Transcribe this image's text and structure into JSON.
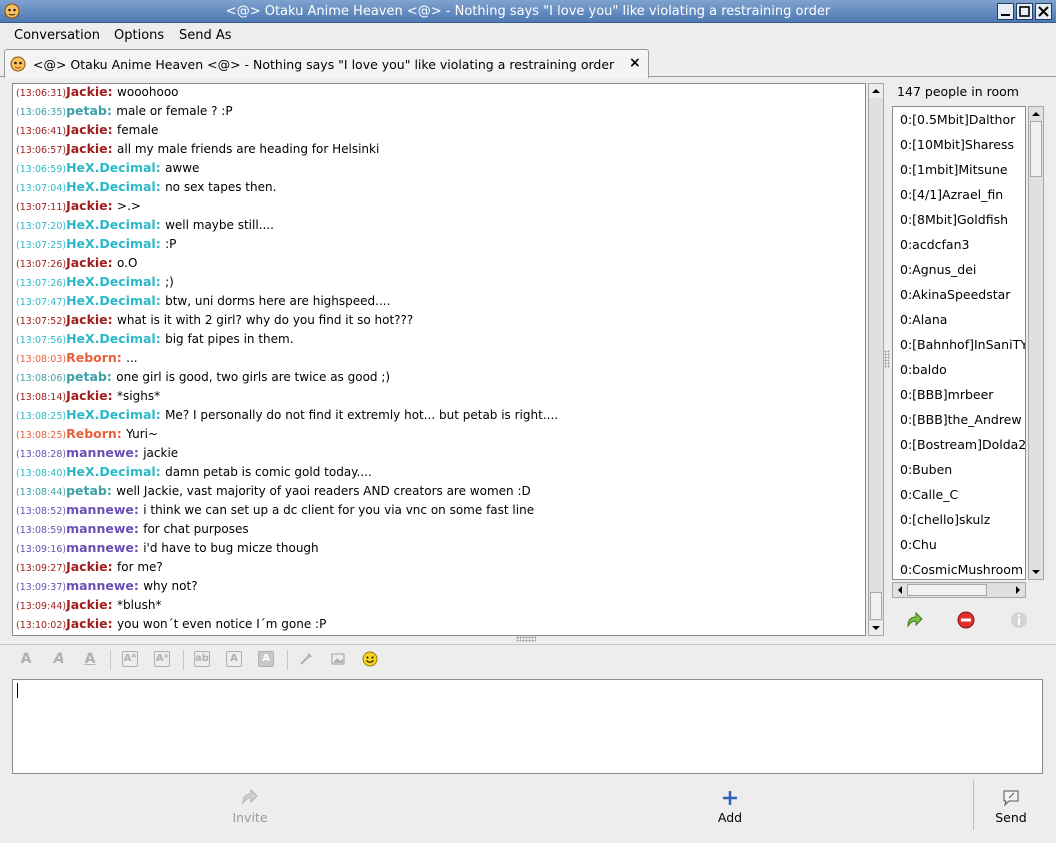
{
  "window": {
    "title": "<@> Otaku Anime Heaven <@> - Nothing says \"I love you\" like violating a restraining order"
  },
  "menu": {
    "conversation": "Conversation",
    "options": "Options",
    "send_as": "Send As"
  },
  "tab": {
    "label": "<@> Otaku Anime Heaven <@> - Nothing says \"I love you\" like violating a restraining order",
    "close": "×"
  },
  "colors": {
    "Jackie": "#a11d1d",
    "petab": "#3e9fa6",
    "HeX.Decimal": "#2bb8c8",
    "Reborn": "#e8603c",
    "mannewe": "#6a4fb3"
  },
  "messages": [
    {
      "time": "(13:06:31)",
      "nick": "Jackie",
      "text": "wooohooo"
    },
    {
      "time": "(13:06:35)",
      "nick": "petab",
      "text": "male or female ? :P"
    },
    {
      "time": "(13:06:41)",
      "nick": "Jackie",
      "text": "female"
    },
    {
      "time": "(13:06:57)",
      "nick": "Jackie",
      "text": "all my male friends are heading for Helsinki"
    },
    {
      "time": "(13:06:59)",
      "nick": "HeX.Decimal",
      "text": "awwe"
    },
    {
      "time": "(13:07:04)",
      "nick": "HeX.Decimal",
      "text": "no sex tapes then."
    },
    {
      "time": "(13:07:11)",
      "nick": "Jackie",
      "text": ">.>"
    },
    {
      "time": "(13:07:20)",
      "nick": "HeX.Decimal",
      "text": "well maybe still...."
    },
    {
      "time": "(13:07:25)",
      "nick": "HeX.Decimal",
      "text": ":P"
    },
    {
      "time": "(13:07:26)",
      "nick": "Jackie",
      "text": "o.O"
    },
    {
      "time": "(13:07:26)",
      "nick": "HeX.Decimal",
      "text": ";)"
    },
    {
      "time": "(13:07:47)",
      "nick": "HeX.Decimal",
      "text": "btw, uni dorms here are highspeed...."
    },
    {
      "time": "(13:07:52)",
      "nick": "Jackie",
      "text": "what is it with 2 girl? why do you find it so hot???"
    },
    {
      "time": "(13:07:56)",
      "nick": "HeX.Decimal",
      "text": "big fat pipes in them."
    },
    {
      "time": "(13:08:03)",
      "nick": "Reborn",
      "text": "..."
    },
    {
      "time": "(13:08:06)",
      "nick": "petab",
      "text": "one girl is good, two girls are twice as good ;)"
    },
    {
      "time": "(13:08:14)",
      "nick": "Jackie",
      "text": "*sighs*"
    },
    {
      "time": "(13:08:25)",
      "nick": "HeX.Decimal",
      "text": "Me? I personally do not find it extremly hot... but petab is right...."
    },
    {
      "time": "(13:08:25)",
      "nick": "Reborn",
      "text": "Yuri~"
    },
    {
      "time": "(13:08:28)",
      "nick": "mannewe",
      "text": "jackie"
    },
    {
      "time": "(13:08:40)",
      "nick": "HeX.Decimal",
      "text": "damn petab is comic gold today...."
    },
    {
      "time": "(13:08:44)",
      "nick": "petab",
      "text": "well Jackie, vast majority of yaoi readers AND creators are women :D"
    },
    {
      "time": "(13:08:52)",
      "nick": "mannewe",
      "text": "i think we can set up a dc client for you via vnc on some fast line"
    },
    {
      "time": "(13:08:59)",
      "nick": "mannewe",
      "text": "for chat purposes"
    },
    {
      "time": "(13:09:16)",
      "nick": "mannewe",
      "text": "i'd have to bug micze though"
    },
    {
      "time": "(13:09:27)",
      "nick": "Jackie",
      "text": "for me?"
    },
    {
      "time": "(13:09:37)",
      "nick": "mannewe",
      "text": "why not?"
    },
    {
      "time": "(13:09:44)",
      "nick": "Jackie",
      "text": "*blush*"
    },
    {
      "time": "(13:10:02)",
      "nick": "Jackie",
      "text": "you won´t even notice I´m gone :P"
    }
  ],
  "room": {
    "people_count": "147 people in room",
    "users": [
      "0:[0.5Mbit]Dalthor",
      "0:[10Mbit]Sharess",
      "0:[1mbit]Mitsune",
      "0:[4/1]Azrael_fin",
      "0:[8Mbit]Goldfish",
      "0:acdcfan3",
      "0:Agnus_dei",
      "0:AkinaSpeedstar",
      "0:Alana",
      "0:[Bahnhof]InSaniTY",
      "0:baldo",
      "0:[BBB]mrbeer",
      "0:[BBB]the_Andrew",
      "0:[Bostream]Dolda2",
      "0:Buben",
      "0:Calle_C",
      "0:[chello]skulz",
      "0:Chu",
      "0:CosmicMushroom"
    ]
  },
  "input": {
    "value": ""
  },
  "buttons": {
    "invite": "Invite",
    "add": "Add",
    "send": "Send"
  }
}
